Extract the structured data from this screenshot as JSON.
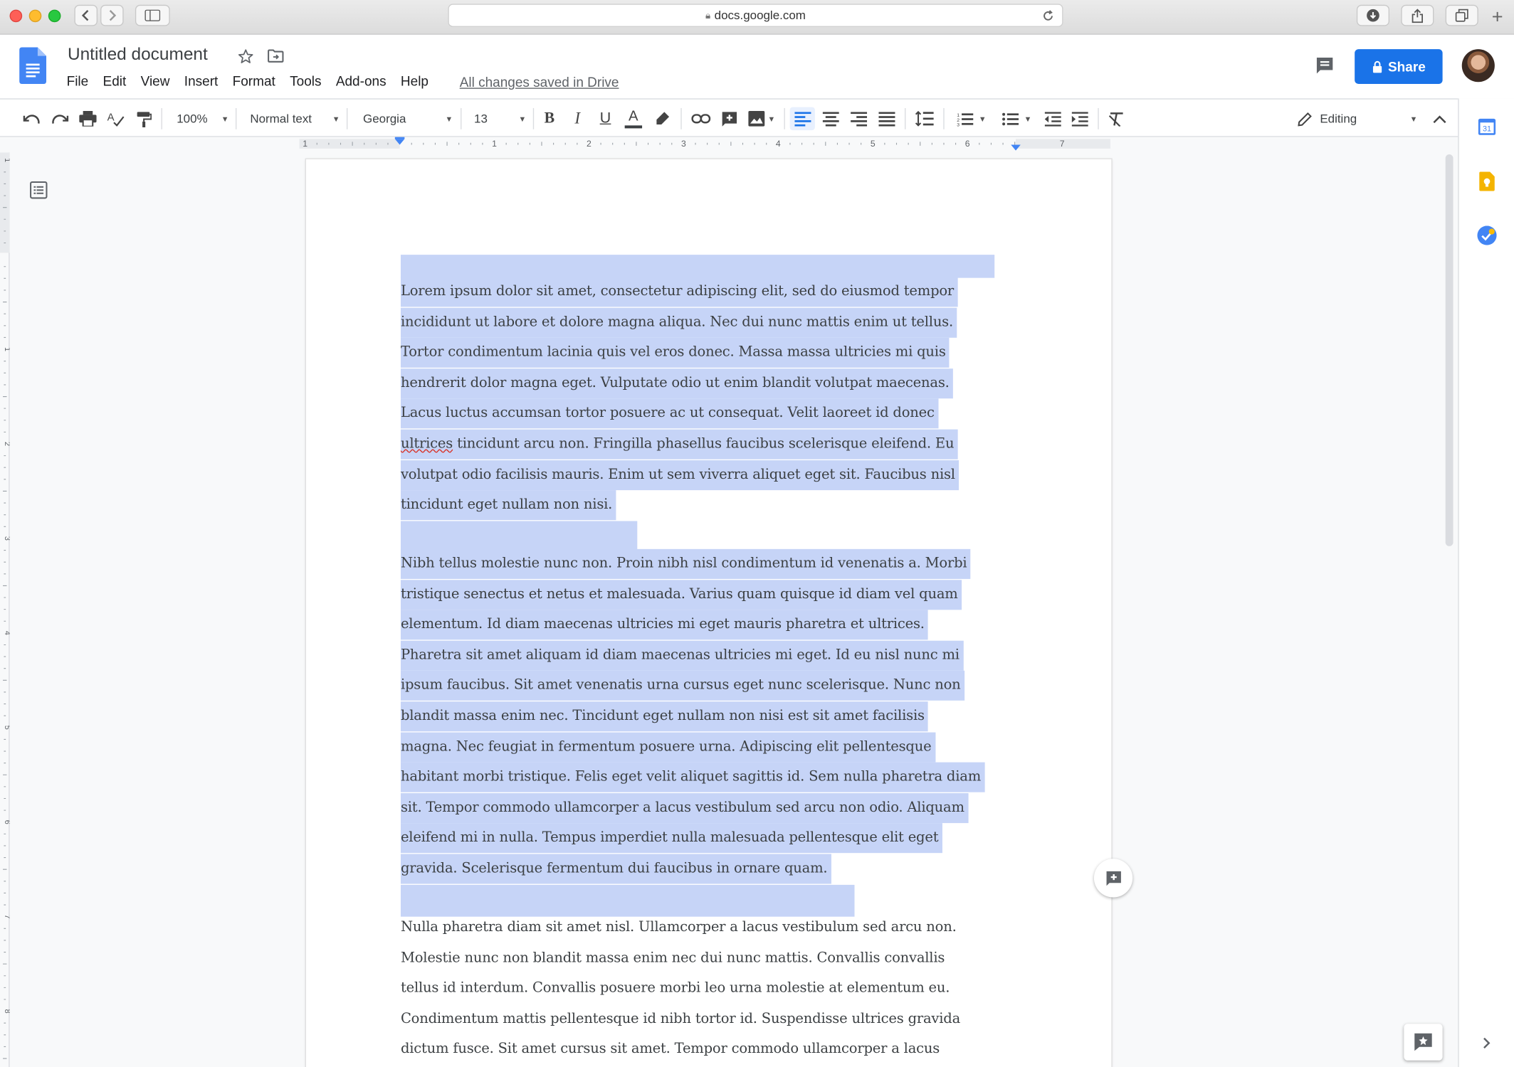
{
  "browser": {
    "url": "docs.google.com"
  },
  "doc": {
    "title": "Untitled document",
    "menu": [
      "File",
      "Edit",
      "View",
      "Insert",
      "Format",
      "Tools",
      "Add-ons",
      "Help"
    ],
    "saved_status": "All changes saved in Drive",
    "share_label": "Share"
  },
  "toolbar": {
    "zoom": "100%",
    "style": "Normal text",
    "font": "Georgia",
    "size": "13",
    "mode": "Editing"
  },
  "ruler": {
    "labels": [
      "1",
      "1",
      "2",
      "3",
      "4",
      "5",
      "6",
      "7"
    ]
  },
  "vruler": {
    "labels": [
      "1",
      "1",
      "2",
      "3",
      "4",
      "5",
      "6",
      "7",
      "8"
    ]
  },
  "paragraphs": [
    {
      "lines": [
        "Lorem ipsum dolor sit amet, consectetur adipiscing elit, sed do eiusmod tempor",
        "incididunt ut labore et dolore magna aliqua. Nec dui nunc mattis enim ut tellus.",
        "Tortor condimentum lacinia quis vel eros donec. Massa massa ultricies mi quis",
        "hendrerit dolor magna eget. Vulputate odio ut enim blandit volutpat maecenas.",
        "Lacus luctus accumsan tortor posuere ac ut consequat. Velit laoreet id donec",
        "ultrices tincidunt arcu non. Fringilla phasellus faucibus scelerisque eleifend. Eu",
        "volutpat odio facilisis mauris. Enim ut sem viverra aliquet eget sit. Faucibus nisl",
        "tincidunt eget nullam non nisi."
      ],
      "selected": true
    },
    {
      "lines": [
        "Nibh tellus molestie nunc non. Proin nibh nisl condimentum id venenatis a. Morbi",
        "tristique senectus et netus et malesuada. Varius quam quisque id diam vel quam",
        "elementum. Id diam maecenas ultricies mi eget mauris pharetra et ultrices.",
        "Pharetra sit amet aliquam id diam maecenas ultricies mi eget. Id eu nisl nunc mi",
        "ipsum faucibus. Sit amet venenatis urna cursus eget nunc scelerisque. Nunc non",
        "blandit massa enim nec. Tincidunt eget nullam non nisi est sit amet facilisis",
        "magna. Nec feugiat in fermentum posuere urna. Adipiscing elit pellentesque",
        "habitant morbi tristique. Felis eget velit aliquet sagittis id. Sem nulla pharetra diam",
        "sit. Tempor commodo ullamcorper a lacus vestibulum sed arcu non odio. Aliquam",
        "eleifend mi in nulla. Tempus imperdiet nulla malesuada pellentesque elit eget",
        "gravida. Scelerisque fermentum dui faucibus in ornare quam."
      ],
      "selected": true
    },
    {
      "lines": [
        "Nulla pharetra diam sit amet nisl. Ullamcorper a lacus vestibulum sed arcu non.",
        "Molestie nunc non blandit massa enim nec dui nunc mattis. Convallis convallis",
        "tellus id interdum. Convallis posuere morbi leo urna molestie at elementum eu.",
        "Condimentum mattis pellentesque id nibh tortor id. Suspendisse ultrices gravida",
        "dictum fusce. Sit amet cursus sit amet. Tempor commodo ullamcorper a lacus"
      ],
      "selected": false
    }
  ],
  "colors": {
    "accent": "#1a73e8",
    "selection": "#c6d4f7",
    "text": "#3c4043"
  },
  "side_icons": [
    "calendar-icon",
    "keep-icon",
    "tasks-icon"
  ]
}
